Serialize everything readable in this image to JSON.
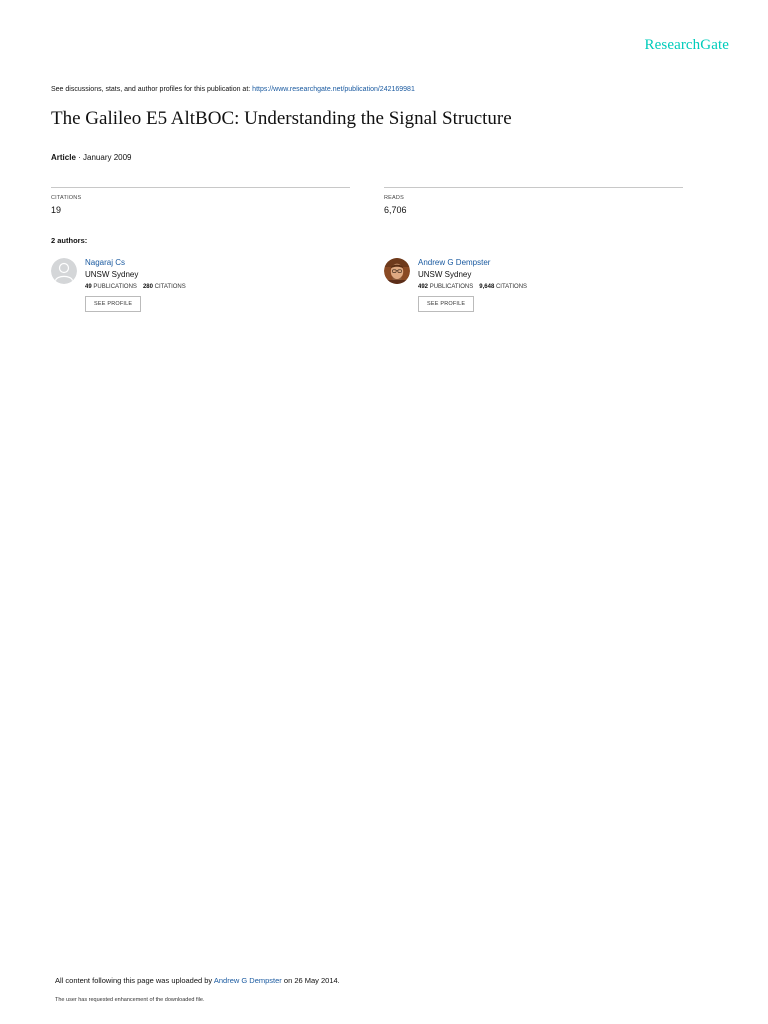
{
  "brand": "ResearchGate",
  "discussion": {
    "prefix": "See discussions, stats, and author profiles for this publication at: ",
    "url": "https://www.researchgate.net/publication/242169981"
  },
  "publication": {
    "title": "The Galileo E5 AltBOC: Understanding the Signal Structure",
    "type": "Article",
    "separator": " · ",
    "date": "January 2009"
  },
  "stats": {
    "citations": {
      "label": "CITATIONS",
      "value": "19"
    },
    "reads": {
      "label": "READS",
      "value": "6,706"
    }
  },
  "authors_heading": "2 authors:",
  "authors": [
    {
      "name": "Nagaraj Cs",
      "institution": "UNSW Sydney",
      "publications": "49",
      "publications_label": "PUBLICATIONS",
      "citations": "280",
      "citations_label": "CITATIONS",
      "button": "SEE PROFILE",
      "avatar_icon": "default-user-avatar-icon"
    },
    {
      "name": "Andrew G Dempster",
      "institution": "UNSW Sydney",
      "publications": "492",
      "publications_label": "PUBLICATIONS",
      "citations": "9,648",
      "citations_label": "CITATIONS",
      "button": "SEE PROFILE",
      "avatar_icon": "author-photo-icon"
    }
  ],
  "footer": {
    "upload_prefix": "All content following this page was uploaded by ",
    "uploader": "Andrew G Dempster",
    "upload_suffix": " on 26 May 2014.",
    "note": "The user has requested enhancement of the downloaded file."
  },
  "colors": {
    "brand": "#00ccbb",
    "link": "#1a5aa0"
  }
}
